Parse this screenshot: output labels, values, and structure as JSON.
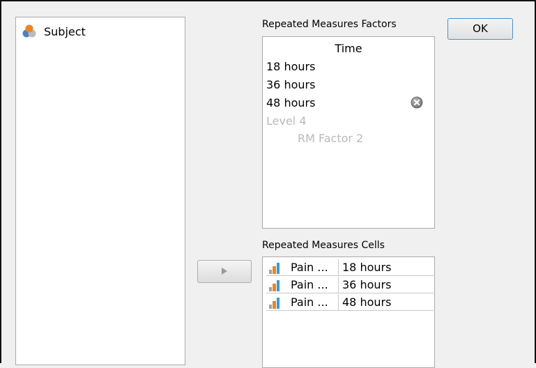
{
  "variables": [
    {
      "label": "Subject",
      "icon": "nominal-variable-icon"
    }
  ],
  "buttons": {
    "ok_label": "OK",
    "move_icon": "right-arrow-icon"
  },
  "rm_factors": {
    "section_label": "Repeated Measures Factors",
    "factor_name": "Time",
    "levels": [
      "18 hours",
      "36 hours",
      "48 hours"
    ],
    "new_level_placeholder": "Level 4",
    "new_factor_placeholder": "RM Factor 2",
    "remove_icon": "remove-circle-icon"
  },
  "rm_cells": {
    "section_label": "Repeated Measures Cells",
    "rows": [
      {
        "variable": "Pain ...",
        "level": "18 hours"
      },
      {
        "variable": "Pain ...",
        "level": "36 hours"
      },
      {
        "variable": "Pain ...",
        "level": "48 hours"
      }
    ]
  },
  "colors": {
    "ok_border": "#4a90c8",
    "nominal_icon": [
      "#e8862a",
      "#4f7fbf",
      "#bbbbbb"
    ],
    "ordinal_icon": [
      "#e8862a",
      "#3a9ad9"
    ]
  }
}
